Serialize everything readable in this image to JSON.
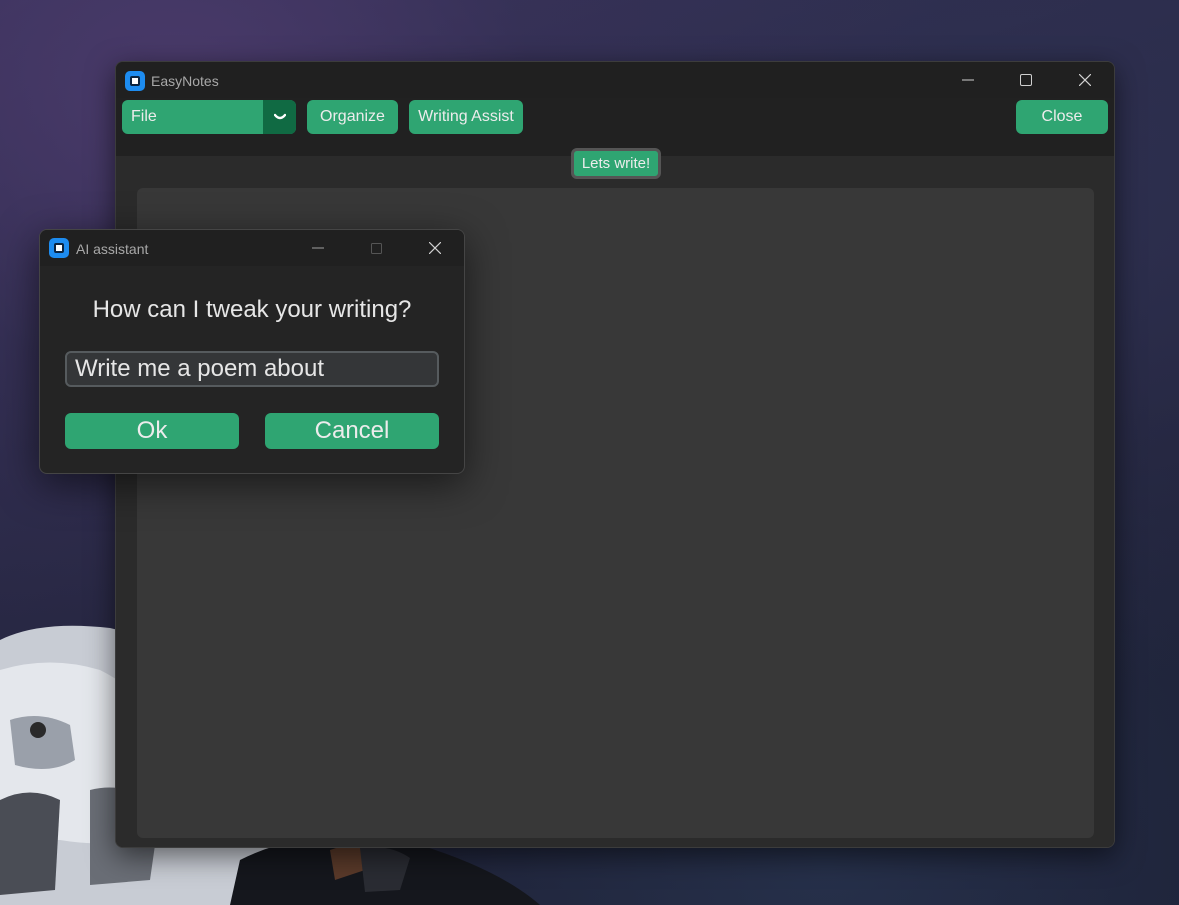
{
  "main_window": {
    "title": "EasyNotes",
    "toolbar": {
      "file_label": "File",
      "organize_label": "Organize",
      "writing_assist_label": "Writing Assist",
      "close_label": "Close"
    },
    "lets_write_label": "Lets write!"
  },
  "dialog": {
    "title": "AI assistant",
    "prompt": "How can I tweak your writing?",
    "input_value": "Write me a poem about",
    "ok_label": "Ok",
    "cancel_label": "Cancel"
  },
  "colors": {
    "accent": "#2fa572",
    "accent_dark": "#106a43",
    "window_bg": "#242424",
    "editor_bg": "#383838",
    "app_icon": "#1d8cf0"
  },
  "icons": [
    "app-icon",
    "minimize-icon",
    "maximize-icon",
    "close-icon",
    "chevron-down-icon"
  ]
}
